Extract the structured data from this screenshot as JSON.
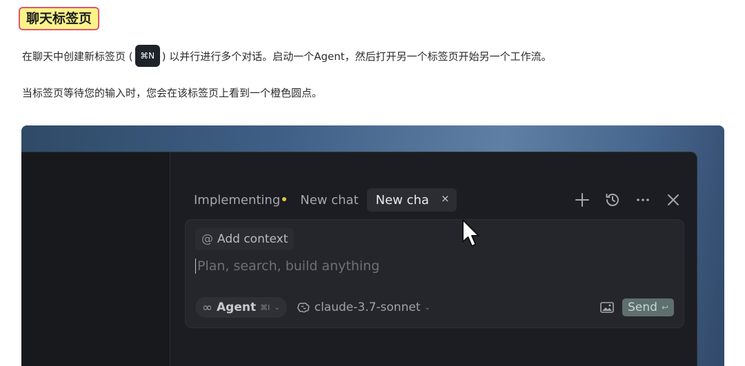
{
  "doc": {
    "heading": "聊天标签页",
    "para1_before": "在聊天中创建新标签页 (",
    "para1_kbd": "⌘N",
    "para1_after": ") 以并行进行多个对话。启动一个Agent，然后打开另一个标签页开始另一个工作流。",
    "para2": "当标签页等待您的输入时，您会在该标签页上看到一个橙色圆点。"
  },
  "tabs": [
    {
      "label": "Implementing",
      "active": false,
      "has_dot": true
    },
    {
      "label": "New chat",
      "active": false,
      "has_dot": false
    },
    {
      "label": "New cha",
      "active": true,
      "has_dot": false
    }
  ],
  "tab_close_glyph": "×",
  "toolbar": {
    "icons": [
      "plus-icon",
      "history-icon",
      "more-icon",
      "close-icon"
    ]
  },
  "composer": {
    "add_context": "Add context",
    "at_glyph": "@",
    "placeholder": "Plan, search, build anything",
    "agent_label": "Agent",
    "agent_shortcut": "⌘I",
    "model": "claude-3.7-sonnet",
    "send_label": "Send",
    "send_glyph": "↩"
  },
  "colors": {
    "tab_dot": "#e2c14b",
    "heading_bg": "#fbf38a",
    "heading_border": "#e0566b",
    "send_bg": "#5f6f6e"
  }
}
